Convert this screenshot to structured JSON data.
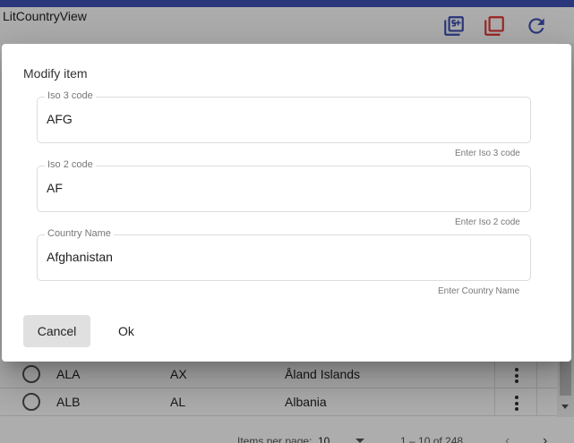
{
  "app": {
    "title": "LitCountryView"
  },
  "header": {
    "icons": [
      "add-multiple-icon",
      "copy-icon",
      "refresh-icon"
    ],
    "colors": {
      "add": "#3f51b5",
      "copy": "#e53935",
      "refresh": "#3f51b5",
      "stripe": "#3f51b5"
    }
  },
  "table": {
    "rows": [
      {
        "iso3": "ALA",
        "iso2": "AX",
        "name": "Åland Islands"
      },
      {
        "iso3": "ALB",
        "iso2": "AL",
        "name": "Albania"
      }
    ]
  },
  "paginator": {
    "label": "Items per page:",
    "page_size": "10",
    "range": "1 – 10 of 248",
    "prev": "‹",
    "next": "›"
  },
  "dialog": {
    "title": "Modify item",
    "fields": [
      {
        "label": "Iso 3 code",
        "value": "AFG",
        "hint": "Enter Iso 3 code"
      },
      {
        "label": "Iso 2 code",
        "value": "AF",
        "hint": "Enter Iso 2 code"
      },
      {
        "label": "Country Name",
        "value": "Afghanistan",
        "hint": "Enter Country Name"
      }
    ],
    "cancel_label": "Cancel",
    "ok_label": "Ok"
  }
}
